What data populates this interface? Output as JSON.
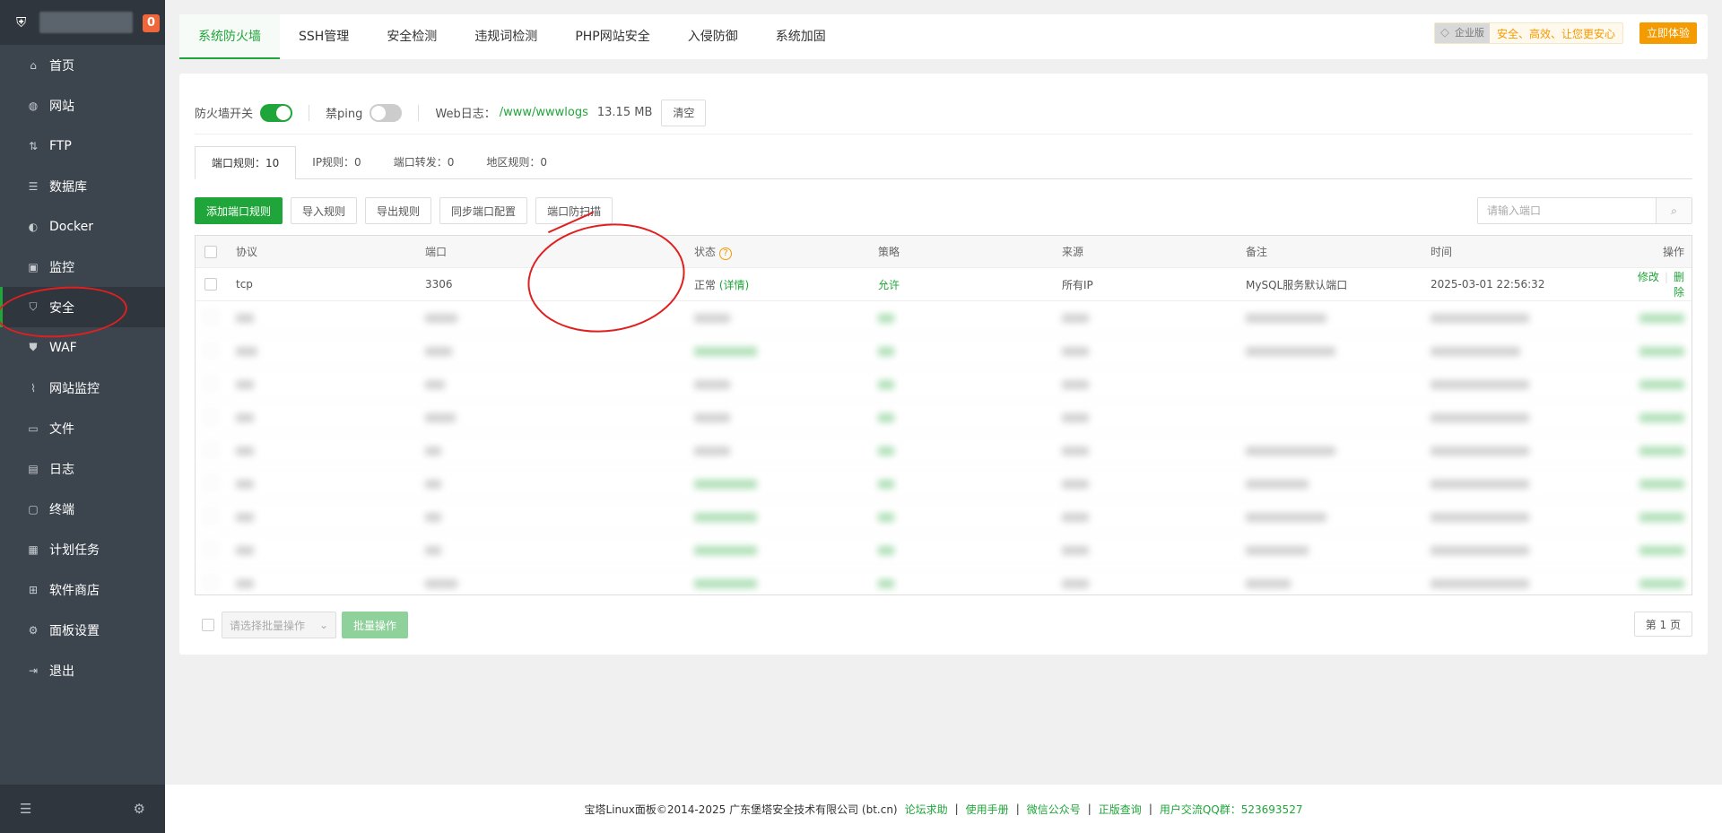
{
  "sidebar": {
    "badge": "0",
    "items": [
      {
        "label": "首页",
        "icon": "home-icon"
      },
      {
        "label": "网站",
        "icon": "globe-icon"
      },
      {
        "label": "FTP",
        "icon": "ftp-icon"
      },
      {
        "label": "数据库",
        "icon": "database-icon"
      },
      {
        "label": "Docker",
        "icon": "docker-icon"
      },
      {
        "label": "监控",
        "icon": "monitor-icon"
      },
      {
        "label": "安全",
        "icon": "shield-icon"
      },
      {
        "label": "WAF",
        "icon": "waf-icon"
      },
      {
        "label": "网站监控",
        "icon": "chart-icon"
      },
      {
        "label": "文件",
        "icon": "folder-icon"
      },
      {
        "label": "日志",
        "icon": "log-icon"
      },
      {
        "label": "终端",
        "icon": "terminal-icon"
      },
      {
        "label": "计划任务",
        "icon": "calendar-icon"
      },
      {
        "label": "软件商店",
        "icon": "grid-icon"
      },
      {
        "label": "面板设置",
        "icon": "settings-icon"
      },
      {
        "label": "退出",
        "icon": "logout-icon"
      }
    ],
    "active": "安全"
  },
  "tabs": [
    "系统防火墙",
    "SSH管理",
    "安全检测",
    "违规词检测",
    "PHP网站安全",
    "入侵防御",
    "系统加固"
  ],
  "enterprise": {
    "tag": "企业版",
    "slogan": "安全、高效、让您更安心",
    "button": "立即体验"
  },
  "firewall": {
    "switch_label": "防火墙开关",
    "switch_on": true,
    "ping_label": "禁ping",
    "ping_on": false,
    "weblog_label": "Web日志：",
    "weblog_path": "/www/wwwlogs",
    "weblog_size": "13.15 MB",
    "clear_label": "清空"
  },
  "subtabs": [
    "端口规则：10",
    "IP规则：0",
    "端口转发：0",
    "地区规则：0"
  ],
  "toolbar": {
    "add": "添加端口规则",
    "import": "导入规则",
    "export": "导出规则",
    "sync": "同步端口配置",
    "scan": "端口防扫描",
    "search_placeholder": "请输入端口"
  },
  "table": {
    "headers": [
      "协议",
      "端口",
      "状态",
      "策略",
      "来源",
      "备注",
      "时间",
      "操作"
    ],
    "rows": [
      {
        "protocol": "tcp",
        "port": "3306",
        "status": "正常",
        "detail": "(详情)",
        "policy": "允许",
        "source": "所有IP",
        "remark": "MySQL服务默认端口",
        "time": "2025-03-01 22:56:32",
        "edit": "修改",
        "delete": "删除"
      }
    ],
    "obscured_rows": 9
  },
  "footer_ctrl": {
    "batch_placeholder": "请选择批量操作",
    "batch_button": "批量操作",
    "page": "第 1 页"
  },
  "bottom": {
    "copyright": "宝塔Linux面板©2014-2025 广东堡塔安全技术有限公司 (bt.cn)",
    "links": [
      "论坛求助",
      "使用手册",
      "微信公众号",
      "正版查询"
    ],
    "qq_group": "用户交流QQ群：523693527"
  },
  "colors": {
    "accent": "#20a53a",
    "sidebar": "#3c444d",
    "annotation": "#e02020",
    "enterprise": "#f39b00"
  }
}
